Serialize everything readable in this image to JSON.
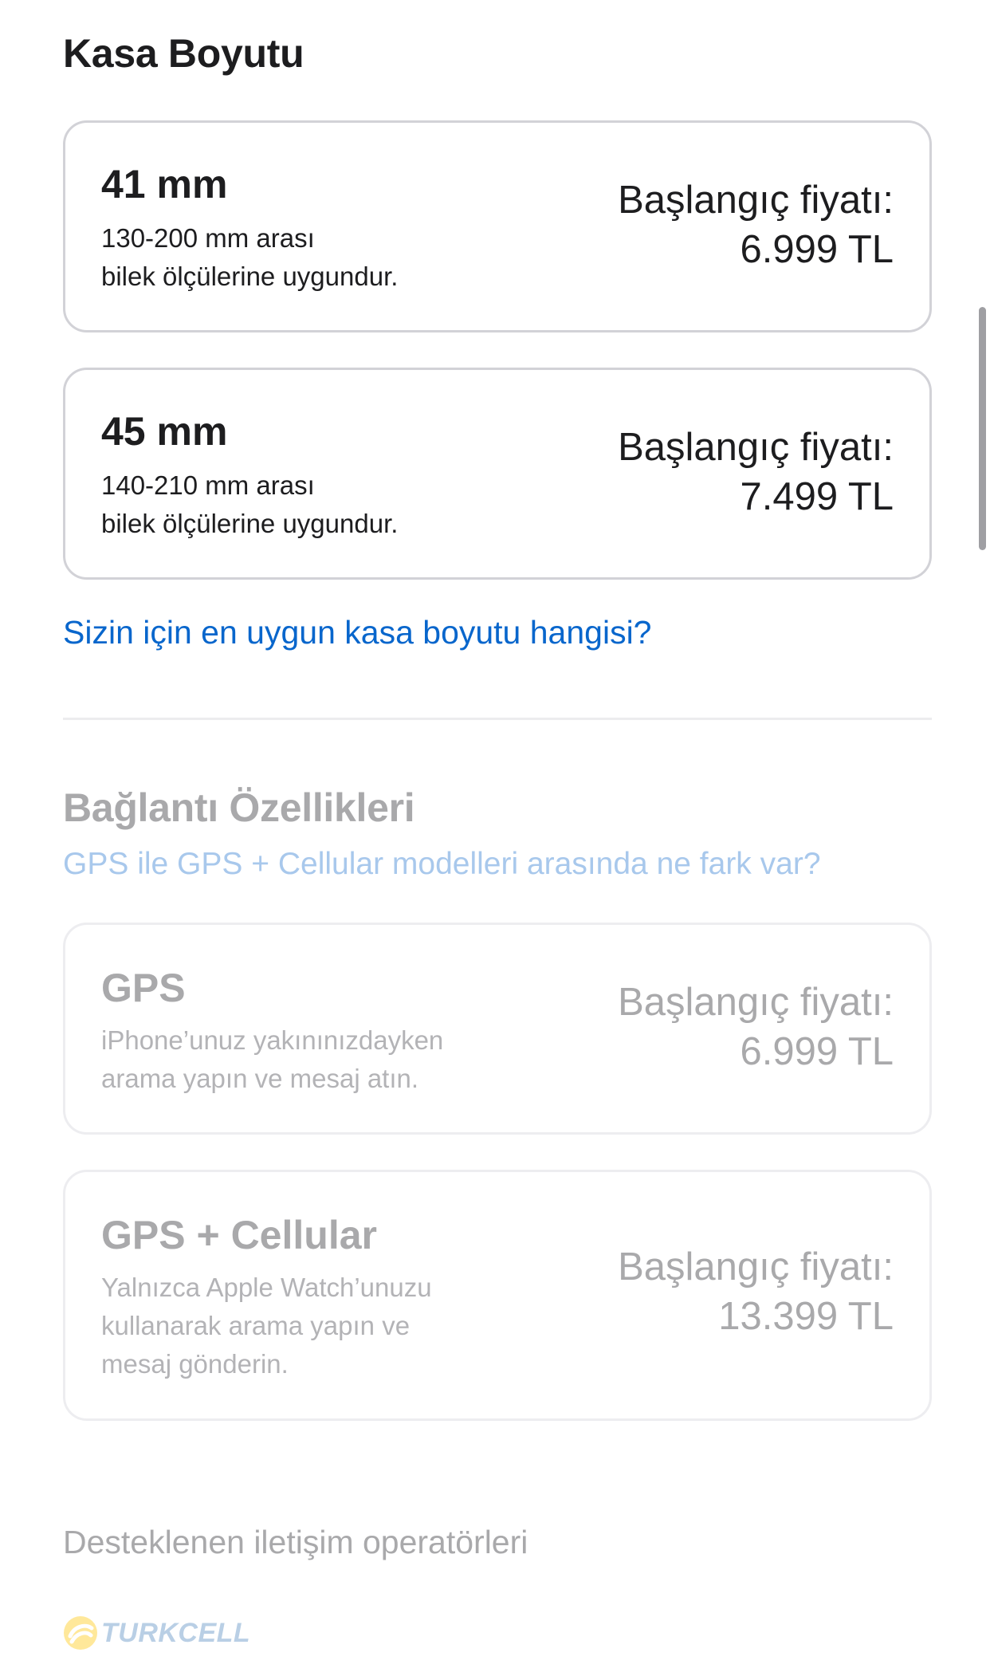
{
  "case_size": {
    "title": "Kasa Boyutu",
    "options": [
      {
        "size": "41 mm",
        "desc_line1": "130-200 mm arası",
        "desc_line2": "bilek ölçülerine uygundur.",
        "price_label": "Başlangıç fiyatı:",
        "price": "6.999 TL"
      },
      {
        "size": "45 mm",
        "desc_line1": "140-210 mm arası",
        "desc_line2": "bilek ölçülerine uygundur.",
        "price_label": "Başlangıç fiyatı:",
        "price": "7.499 TL"
      }
    ],
    "help_link": "Sizin için en uygun kasa boyutu hangisi?"
  },
  "connectivity": {
    "title": "Bağlantı Özellikleri",
    "help_link": "GPS ile GPS + Cellular modelleri arasında ne fark var?",
    "options": [
      {
        "name": "GPS",
        "desc_line1": "iPhone’unuz yakınınızdayken",
        "desc_line2": "arama yapın ve mesaj atın.",
        "price_label": "Başlangıç fiyatı:",
        "price": "6.999 TL"
      },
      {
        "name": "GPS + Cellular",
        "desc_line1": "Yalnızca Apple Watch’unuzu",
        "desc_line2": "kullanarak arama yapın ve",
        "desc_line3": "mesaj gönderin.",
        "price_label": "Başlangıç fiyatı:",
        "price": "13.399 TL"
      }
    ]
  },
  "carriers": {
    "label": "Desteklenen iletişim operatörleri",
    "logo_text": "TURKCELL"
  },
  "colors": {
    "link": "#0866cc",
    "disabled_text": "#a9a9ab",
    "turkcell_yellow": "#ffe89a",
    "turkcell_blue": "#b9cfe5"
  }
}
